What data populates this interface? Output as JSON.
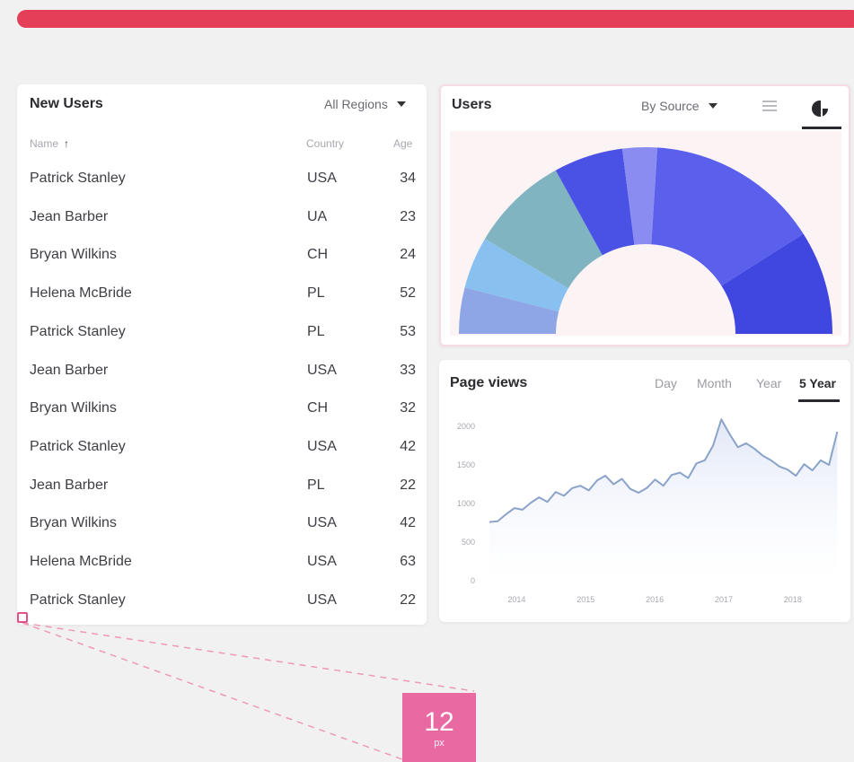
{
  "users_table": {
    "title": "New Users",
    "filter": "All Regions",
    "columns": {
      "name": "Name",
      "country": "Country",
      "age": "Age"
    },
    "rows": [
      {
        "name": "Patrick Stanley",
        "country": "USA",
        "age": "34"
      },
      {
        "name": "Jean Barber",
        "country": "UA",
        "age": "23"
      },
      {
        "name": "Bryan Wilkins",
        "country": "CH",
        "age": "24"
      },
      {
        "name": "Helena McBride",
        "country": "PL",
        "age": "52"
      },
      {
        "name": "Patrick Stanley",
        "country": "PL",
        "age": "53"
      },
      {
        "name": "Jean Barber",
        "country": "USA",
        "age": "33"
      },
      {
        "name": "Bryan Wilkins",
        "country": "CH",
        "age": "32"
      },
      {
        "name": "Patrick Stanley",
        "country": "USA",
        "age": "42"
      },
      {
        "name": "Jean Barber",
        "country": "PL",
        "age": "22"
      },
      {
        "name": "Bryan Wilkins",
        "country": "USA",
        "age": "42"
      },
      {
        "name": "Helena McBride",
        "country": "USA",
        "age": "63"
      },
      {
        "name": "Patrick Stanley",
        "country": "USA",
        "age": "22"
      }
    ]
  },
  "users_chart": {
    "title": "Users",
    "filter": "By Source",
    "view_icons": [
      "list-icon",
      "pie-chart-icon"
    ],
    "active_view": "pie-chart-icon"
  },
  "page_views": {
    "title": "Page views",
    "tabs": [
      "Day",
      "Month",
      "Year",
      "5 Year"
    ],
    "active_tab": "5 Year"
  },
  "spacing_annotation": {
    "value": "12",
    "unit": "px"
  },
  "colors": {
    "top_bar": "#e53e58",
    "line": "#8aa3c8",
    "area_fill": "#dfe6f6",
    "donut_segments": [
      "#8ea6e6",
      "#88c1f0",
      "#7fb4c0",
      "#4a52e6",
      "#8a8cf2",
      "#5b60ec",
      "#3f47e0"
    ],
    "spacing_badge": "#e96aa3"
  },
  "chart_data": [
    {
      "type": "pie",
      "title": "Users",
      "variant": "half-donut",
      "slices": [
        {
          "value": 8
        },
        {
          "value": 9
        },
        {
          "value": 17
        },
        {
          "value": 12
        },
        {
          "value": 6
        },
        {
          "value": 30
        },
        {
          "value": 18
        }
      ],
      "segment_colors": [
        "#8ea6e6",
        "#88c1f0",
        "#7fb4c0",
        "#4a52e6",
        "#8a8cf2",
        "#5b60ec",
        "#3f47e0"
      ]
    },
    {
      "type": "area",
      "title": "Page views",
      "x_ticks": [
        "2014",
        "2015",
        "2016",
        "2017",
        "2018"
      ],
      "y_ticks": [
        "0",
        "500",
        "1000",
        "1500",
        "2000"
      ],
      "ylim": [
        0,
        2000
      ],
      "xlim": [
        2013.8,
        2018.9
      ],
      "grid": false,
      "x": [
        2013.8,
        2013.92,
        2014.04,
        2014.16,
        2014.28,
        2014.4,
        2014.52,
        2014.64,
        2014.76,
        2014.88,
        2015.0,
        2015.12,
        2015.24,
        2015.36,
        2015.48,
        2015.6,
        2015.72,
        2015.84,
        2015.96,
        2016.08,
        2016.2,
        2016.32,
        2016.44,
        2016.56,
        2016.68,
        2016.8,
        2016.92,
        2017.04,
        2017.16,
        2017.28,
        2017.4,
        2017.52,
        2017.64,
        2017.76,
        2017.88,
        2018.0,
        2018.12,
        2018.24,
        2018.36,
        2018.48,
        2018.6,
        2018.72,
        2018.84
      ],
      "values": [
        760,
        770,
        860,
        940,
        920,
        1010,
        1080,
        1020,
        1150,
        1100,
        1200,
        1230,
        1170,
        1300,
        1360,
        1250,
        1320,
        1190,
        1140,
        1200,
        1310,
        1230,
        1370,
        1400,
        1330,
        1520,
        1560,
        1750,
        2090,
        1900,
        1730,
        1780,
        1710,
        1620,
        1560,
        1480,
        1440,
        1360,
        1510,
        1430,
        1560,
        1500,
        1930
      ]
    }
  ]
}
